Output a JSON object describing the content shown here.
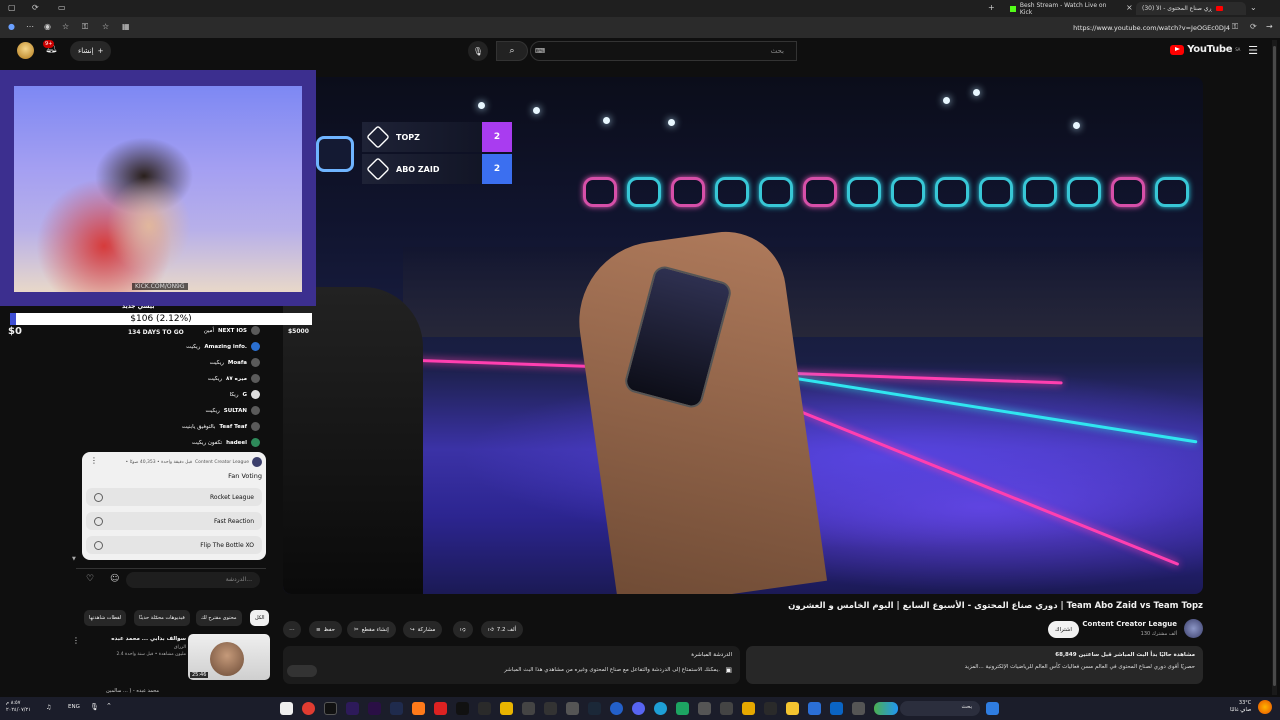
{
  "browser": {
    "tabs": [
      {
        "title": "Besh Stream - Watch Live on Kick",
        "active": false
      },
      {
        "title": "(30) دوري صناع المحتوى - الأ",
        "active": true
      }
    ],
    "url": "https://www.youtube.com/watch?v=JeOGEc0DJ4"
  },
  "youtube": {
    "logo_text": "YouTube",
    "logo_suffix": "SA",
    "search_placeholder": "بحث",
    "search_value": "",
    "create_label": "إنشاء",
    "notification_count": "9+"
  },
  "overlay": {
    "kick_tag": "KICK.COM/ON9G",
    "goal_title": "بيسي جديد",
    "goal_text": "$106 (2.12%)",
    "goal_progress": 2.12,
    "goal_start": "$0",
    "goal_end": "$5000",
    "goal_days": "134 DAYS TO GO"
  },
  "scoreboard": {
    "teams": [
      {
        "name": "TOPZ",
        "score": "2"
      },
      {
        "name": "ABO ZAID",
        "score": "2"
      }
    ]
  },
  "chat": {
    "messages": [
      {
        "user": "NEXT IOS",
        "text": "أمين"
      },
      {
        "user": "Amazing info.",
        "text": "ريكيت"
      },
      {
        "user": "Moafa",
        "text": "ريكيت"
      },
      {
        "user": "ميره ٨٧",
        "text": "ريكيت"
      },
      {
        "user": "G",
        "text": "ريكا"
      },
      {
        "user": "SULTAN",
        "text": "ريكيت"
      },
      {
        "user": "Teaf Teaf",
        "text": "بالتوفيق يابنيت"
      },
      {
        "user": "hadeel",
        "text": "تكفون ريكيت"
      }
    ],
    "input_placeholder": "الدردشة...",
    "poll": {
      "channel": "Content Creator League",
      "meta": "• قبل دقيقة واحدة • 40,353 صوتًا",
      "question": "Fan Voting",
      "options": [
        "Rocket League",
        "Fast Reaction",
        "Flip The Bottle XO"
      ]
    }
  },
  "chips": [
    "الكل",
    "محتوى مقترح لك",
    "فيديوهات محمّلة حديثًا",
    "لقطات شاهدتها"
  ],
  "related": {
    "title": "سوالف بذابي ... محمد عبده",
    "channel": "الزراق",
    "meta": "2.4 مليون مشاهدة • قبل سنة واحدة",
    "duration": "25:46",
    "next_title": "محمد عبده - ( ... سالمين"
  },
  "video": {
    "title": "دوري صناع المحتوى - الأسبوع السابع | اليوم الخامس و العشرون | Team Abo Zaid vs Team Topz",
    "channel": "Content Creator League",
    "subscribers": "130 ألف مشترك",
    "subscribe_label": "اشتراك",
    "likes": "7.2 ألف",
    "share_label": "مشاركة",
    "clip_label": "إنشاء مقطع",
    "save_label": "حفظ",
    "more_label": "⋯"
  },
  "description": {
    "line1": "68,849 مشاهدة حاليًا بدأ البث المباشر قبل ساعتين",
    "line2": "حصريًا أقوى دوري لصناع المحتوى في العالم مسن فعاليات كأس العالم للرياضيات الإلكترونية ...المزيد"
  },
  "livechat_card": {
    "title": "الدردشة المباشرة",
    "text": "يمكنك الاستمتاع إلى الدردشة والتفاعل مع صناع المحتوى وغيره من مشاهدي هذا البث المباشر."
  },
  "taskbar": {
    "time": "٨:٥٧ م",
    "date": "٢٠٢٤/٠٧/٢١",
    "lang": "ENG",
    "weather_temp": "33°C",
    "weather_desc": "صافٍ غالبًا",
    "search_label": "بحث"
  },
  "colors": {
    "youtube_red": "#ff0000",
    "score_purple": "#a93cf0",
    "score_blue": "#3b6ff0",
    "webcam_frame": "#3c2f8f"
  }
}
